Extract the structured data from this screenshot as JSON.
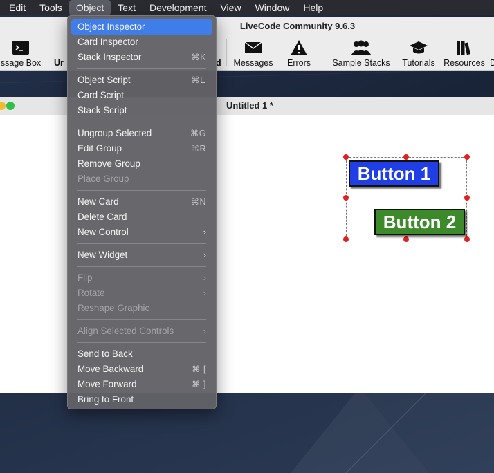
{
  "menubar": {
    "items": [
      {
        "label": "Edit"
      },
      {
        "label": "Tools"
      },
      {
        "label": "Object"
      },
      {
        "label": "Text"
      },
      {
        "label": "Development"
      },
      {
        "label": "View"
      },
      {
        "label": "Window"
      },
      {
        "label": "Help"
      }
    ],
    "active": "Object"
  },
  "toolbar": {
    "title": "LiveCode Community 9.6.3",
    "items": [
      {
        "label": "ssage Box",
        "icon": "terminal-icon"
      },
      {
        "label": "Ur",
        "icon": "undo-icon"
      },
      {
        "label": "d",
        "icon": "partial-icon"
      },
      {
        "label": "Messages",
        "icon": "envelope-icon"
      },
      {
        "label": "Errors",
        "icon": "warning-icon"
      },
      {
        "label": "Sample Stacks",
        "icon": "people-icon"
      },
      {
        "label": "Tutorials",
        "icon": "mortarboard-icon"
      },
      {
        "label": "Resources",
        "icon": "books-icon"
      },
      {
        "label": "D",
        "icon": "partial-icon"
      }
    ]
  },
  "stack": {
    "title": "Untitled 1 *",
    "buttons": [
      {
        "label": "Button 1",
        "color": "#1f3ee6"
      },
      {
        "label": "Button 2",
        "color": "#3d8a2a"
      }
    ],
    "selection_handle_color": "#e32020"
  },
  "object_menu": {
    "groups": [
      [
        {
          "label": "Object Inspector",
          "shortcut": "",
          "highlight": true
        },
        {
          "label": "Card Inspector",
          "shortcut": ""
        },
        {
          "label": "Stack Inspector",
          "shortcut": "⌘K"
        }
      ],
      [
        {
          "label": "Object Script",
          "shortcut": "⌘E"
        },
        {
          "label": "Card Script",
          "shortcut": ""
        },
        {
          "label": "Stack Script",
          "shortcut": ""
        }
      ],
      [
        {
          "label": "Ungroup Selected",
          "shortcut": "⌘G"
        },
        {
          "label": "Edit Group",
          "shortcut": "⌘R"
        },
        {
          "label": "Remove Group",
          "shortcut": ""
        },
        {
          "label": "Place Group",
          "shortcut": "",
          "disabled": true
        }
      ],
      [
        {
          "label": "New Card",
          "shortcut": "⌘N"
        },
        {
          "label": "Delete Card",
          "shortcut": ""
        },
        {
          "label": "New Control",
          "shortcut": "",
          "submenu": true
        }
      ],
      [
        {
          "label": "New Widget",
          "shortcut": "",
          "submenu": true
        }
      ],
      [
        {
          "label": "Flip",
          "shortcut": "",
          "submenu": true,
          "disabled": true
        },
        {
          "label": "Rotate",
          "shortcut": "",
          "submenu": true,
          "disabled": true
        },
        {
          "label": "Reshape Graphic",
          "shortcut": "",
          "disabled": true
        }
      ],
      [
        {
          "label": "Align Selected Controls",
          "shortcut": "",
          "submenu": true,
          "disabled": true
        }
      ],
      [
        {
          "label": "Send to Back",
          "shortcut": ""
        },
        {
          "label": "Move Backward",
          "shortcut": "⌘ ["
        },
        {
          "label": "Move Forward",
          "shortcut": "⌘ ]"
        },
        {
          "label": "Bring to Front",
          "shortcut": ""
        }
      ]
    ]
  },
  "colors": {
    "menu_highlight": "#3f7ee8",
    "traffic_green": "#2fc048",
    "traffic_yellow": "#f2bc2f"
  }
}
